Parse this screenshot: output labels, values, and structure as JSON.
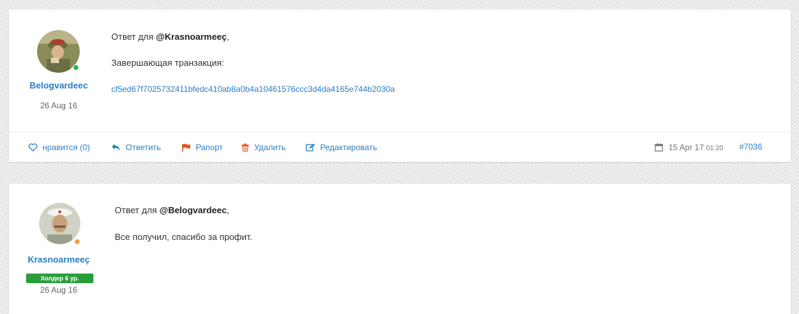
{
  "posts": [
    {
      "author": "Belogvardeec",
      "joined": "26 Aug 16",
      "status_color": "#2bb24c",
      "reply_prefix": "Ответ для ",
      "reply_to": "@Krasnoarmeeç",
      "reply_suffix": ",",
      "line2": "Завершающая транзакция:",
      "tx_hash": "cf5ed67f7025732411bfedc410ab8a0b4a10461576ccc3d4da4165e744b2030a",
      "actions": {
        "like": "нравится (0)",
        "reply": "Ответить",
        "report": "Рапорт",
        "delete": "Удалить",
        "edit": "Редактировать"
      },
      "date": "15 Apr 17",
      "time": "01:20",
      "post_number": "#7036"
    },
    {
      "author": "Krasnoarmeeç",
      "joined": "26 Aug 16",
      "rank": "Холдер 6 ур.",
      "status_color": "#f0a030",
      "reply_prefix": "Ответ для ",
      "reply_to": "@Belogvardeec",
      "reply_suffix": ",",
      "line2": "Все получил, спасибо за профит."
    }
  ],
  "colors": {
    "accent": "#2a7ec7",
    "report_flag": "#e8551f",
    "delete_icon": "#e8551f",
    "rank_badge": "#2a9d3b"
  }
}
